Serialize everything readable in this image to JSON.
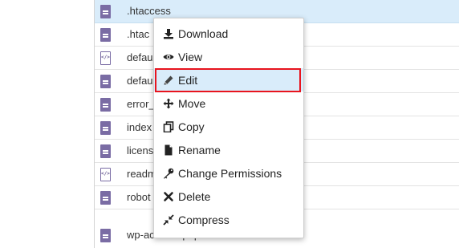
{
  "files": [
    {
      "name": ".htaccess",
      "icon": "file-text-icon",
      "selected": true
    },
    {
      "name": ".htac",
      "icon": "file-text-icon",
      "selected": false
    },
    {
      "name": "defau",
      "icon": "file-code-icon",
      "selected": false
    },
    {
      "name": "defau",
      "icon": "file-text-icon",
      "selected": false
    },
    {
      "name": "error_",
      "icon": "file-text-icon",
      "selected": false
    },
    {
      "name": "index",
      "icon": "file-text-icon",
      "selected": false
    },
    {
      "name": "licens",
      "icon": "file-text-icon",
      "selected": false
    },
    {
      "name": "readm",
      "icon": "file-code-icon",
      "selected": false
    },
    {
      "name": "robot",
      "icon": "file-text-icon",
      "selected": false
    },
    {
      "name": "wp-activate.php",
      "icon": "file-text-icon",
      "selected": false
    }
  ],
  "context_menu": {
    "items": [
      {
        "label": "Download",
        "icon": "download-icon"
      },
      {
        "label": "View",
        "icon": "eye-icon"
      },
      {
        "label": "Edit",
        "icon": "pencil-icon",
        "highlighted": true
      },
      {
        "label": "Move",
        "icon": "move-arrows-icon"
      },
      {
        "label": "Copy",
        "icon": "copy-icon"
      },
      {
        "label": "Rename",
        "icon": "file-icon"
      },
      {
        "label": "Change Permissions",
        "icon": "key-icon"
      },
      {
        "label": "Delete",
        "icon": "times-icon"
      },
      {
        "label": "Compress",
        "icon": "compress-icon"
      }
    ]
  },
  "colors": {
    "file_icon": "#7a6ca4",
    "selected_row": "#d9ecfa",
    "highlight_border": "#e8141e"
  }
}
